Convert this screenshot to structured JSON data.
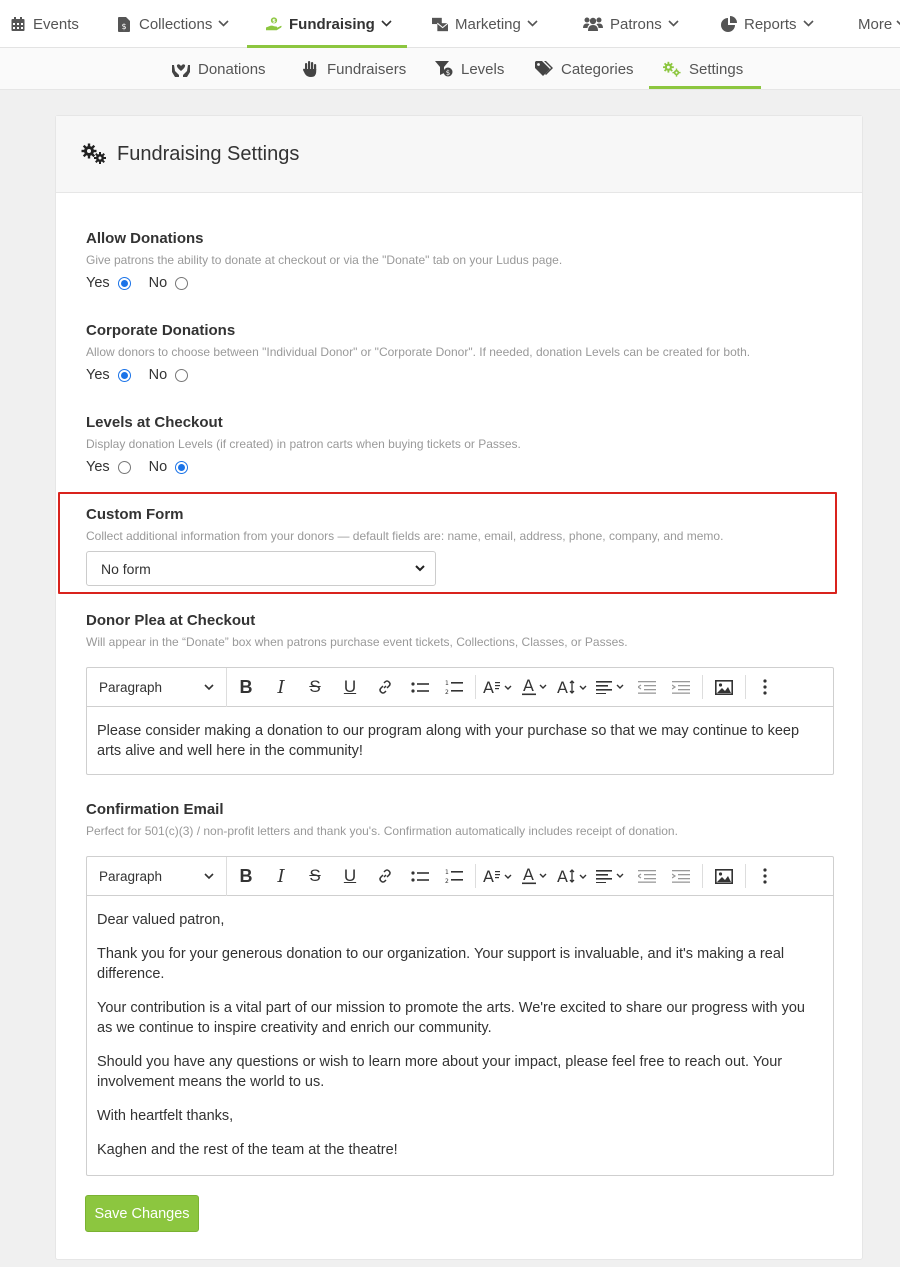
{
  "topnav": {
    "items": [
      {
        "label": "Events"
      },
      {
        "label": "Collections"
      },
      {
        "label": "Fundraising"
      },
      {
        "label": "Marketing"
      },
      {
        "label": "Patrons"
      },
      {
        "label": "Reports"
      },
      {
        "label": "More"
      }
    ]
  },
  "subnav": {
    "items": [
      {
        "label": "Donations"
      },
      {
        "label": "Fundraisers"
      },
      {
        "label": "Levels"
      },
      {
        "label": "Categories"
      },
      {
        "label": "Settings"
      }
    ]
  },
  "card": {
    "title": "Fundraising Settings"
  },
  "settings": {
    "allow_donations": {
      "label": "Allow Donations",
      "help": "Give patrons the ability to donate at checkout or via the \"Donate\" tab on your Ludus page.",
      "yes": "Yes",
      "no": "No",
      "selected": "Yes"
    },
    "corporate_donations": {
      "label": "Corporate Donations",
      "help": "Allow donors to choose between \"Individual Donor\" or \"Corporate Donor\". If needed, donation Levels can be created for both.",
      "yes": "Yes",
      "no": "No",
      "selected": "Yes"
    },
    "levels_at_checkout": {
      "label": "Levels at Checkout",
      "help": "Display donation Levels (if created) in patron carts when buying tickets or Passes.",
      "yes": "Yes",
      "no": "No",
      "selected": "No"
    },
    "custom_form": {
      "label": "Custom Form",
      "help": "Collect additional information from your donors — default fields are: name, email, address, phone, company, and memo.",
      "selected": "No form"
    },
    "donor_plea": {
      "label": "Donor Plea at Checkout",
      "help": "Will appear in the “Donate” box when patrons purchase event tickets, Collections, Classes, or Passes.",
      "block_style": "Paragraph",
      "content": "Please consider making a donation to our program along with your purchase so that we may continue to keep arts alive and well here in the community!"
    },
    "confirmation_email": {
      "label": "Confirmation Email",
      "help": "Perfect for 501(c)(3) / non-profit letters and thank you's. Confirmation automatically includes receipt of donation.",
      "block_style": "Paragraph",
      "paragraphs": [
        "Dear valued patron,",
        "Thank you for your generous donation to our organization. Your support is invaluable, and it's making a real difference.",
        "Your contribution is a vital part of our mission to promote the arts. We're excited to share our progress with you as we continue to inspire creativity and enrich our community.",
        "Should you have any questions or wish to learn more about your impact, please feel free to reach out. Your involvement means the world to us.",
        "With heartfelt thanks,",
        "Kaghen and the rest of the team at the theatre!"
      ]
    }
  },
  "save_label": "Save Changes",
  "colors": {
    "accent": "#8cc63f",
    "radio": "#1a73e8",
    "highlight": "#d9231d"
  }
}
